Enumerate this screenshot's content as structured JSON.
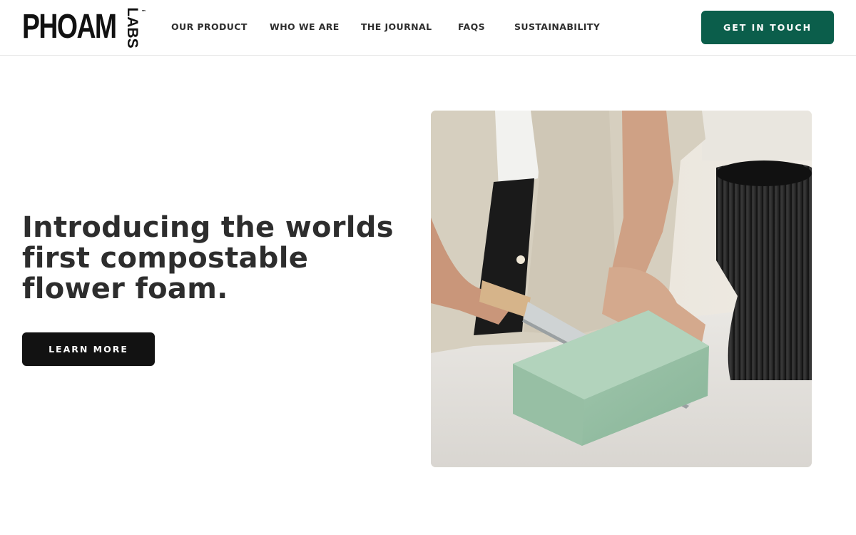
{
  "brand": {
    "name": "PHOAM",
    "sub": "LABS",
    "tm": "™"
  },
  "nav": {
    "items": [
      {
        "label": "OUR PRODUCT"
      },
      {
        "label": "WHO WE ARE"
      },
      {
        "label": "THE JOURNAL"
      },
      {
        "label": "FAQS"
      },
      {
        "label": "SUSTAINABILITY"
      }
    ],
    "cta_label": "GET IN TOUCH"
  },
  "hero": {
    "title_lines": [
      "Introducing the worlds",
      "first compostable",
      "flower foam."
    ],
    "button_label": "LEARN MORE",
    "image_icon": "photo-hand-cutting-foam"
  },
  "colors": {
    "accent": "#0b5e4b",
    "dark_button": "#121212",
    "text": "#2d2d2d"
  }
}
